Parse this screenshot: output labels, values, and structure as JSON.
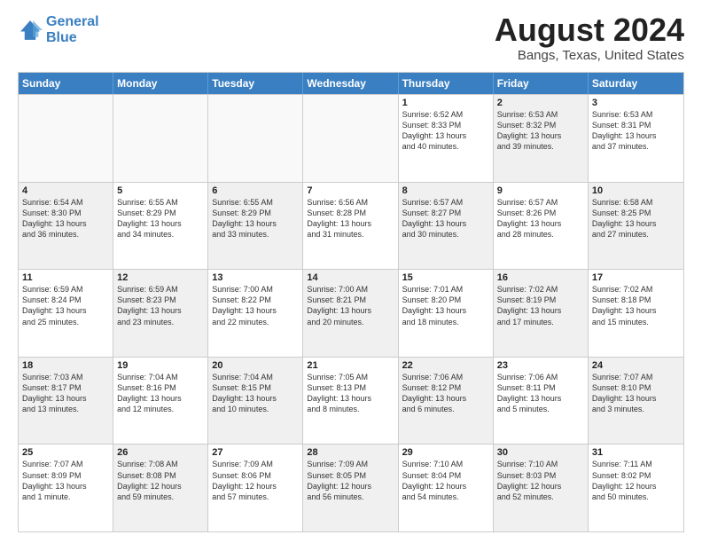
{
  "logo": {
    "line1": "General",
    "line2": "Blue"
  },
  "title": "August 2024",
  "subtitle": "Bangs, Texas, United States",
  "headers": [
    "Sunday",
    "Monday",
    "Tuesday",
    "Wednesday",
    "Thursday",
    "Friday",
    "Saturday"
  ],
  "weeks": [
    [
      {
        "day": "",
        "info": "",
        "shaded": false,
        "empty": true
      },
      {
        "day": "",
        "info": "",
        "shaded": false,
        "empty": true
      },
      {
        "day": "",
        "info": "",
        "shaded": false,
        "empty": true
      },
      {
        "day": "",
        "info": "",
        "shaded": false,
        "empty": true
      },
      {
        "day": "1",
        "info": "Sunrise: 6:52 AM\nSunset: 8:33 PM\nDaylight: 13 hours\nand 40 minutes.",
        "shaded": false,
        "empty": false
      },
      {
        "day": "2",
        "info": "Sunrise: 6:53 AM\nSunset: 8:32 PM\nDaylight: 13 hours\nand 39 minutes.",
        "shaded": true,
        "empty": false
      },
      {
        "day": "3",
        "info": "Sunrise: 6:53 AM\nSunset: 8:31 PM\nDaylight: 13 hours\nand 37 minutes.",
        "shaded": false,
        "empty": false
      }
    ],
    [
      {
        "day": "4",
        "info": "Sunrise: 6:54 AM\nSunset: 8:30 PM\nDaylight: 13 hours\nand 36 minutes.",
        "shaded": true,
        "empty": false
      },
      {
        "day": "5",
        "info": "Sunrise: 6:55 AM\nSunset: 8:29 PM\nDaylight: 13 hours\nand 34 minutes.",
        "shaded": false,
        "empty": false
      },
      {
        "day": "6",
        "info": "Sunrise: 6:55 AM\nSunset: 8:29 PM\nDaylight: 13 hours\nand 33 minutes.",
        "shaded": true,
        "empty": false
      },
      {
        "day": "7",
        "info": "Sunrise: 6:56 AM\nSunset: 8:28 PM\nDaylight: 13 hours\nand 31 minutes.",
        "shaded": false,
        "empty": false
      },
      {
        "day": "8",
        "info": "Sunrise: 6:57 AM\nSunset: 8:27 PM\nDaylight: 13 hours\nand 30 minutes.",
        "shaded": true,
        "empty": false
      },
      {
        "day": "9",
        "info": "Sunrise: 6:57 AM\nSunset: 8:26 PM\nDaylight: 13 hours\nand 28 minutes.",
        "shaded": false,
        "empty": false
      },
      {
        "day": "10",
        "info": "Sunrise: 6:58 AM\nSunset: 8:25 PM\nDaylight: 13 hours\nand 27 minutes.",
        "shaded": true,
        "empty": false
      }
    ],
    [
      {
        "day": "11",
        "info": "Sunrise: 6:59 AM\nSunset: 8:24 PM\nDaylight: 13 hours\nand 25 minutes.",
        "shaded": false,
        "empty": false
      },
      {
        "day": "12",
        "info": "Sunrise: 6:59 AM\nSunset: 8:23 PM\nDaylight: 13 hours\nand 23 minutes.",
        "shaded": true,
        "empty": false
      },
      {
        "day": "13",
        "info": "Sunrise: 7:00 AM\nSunset: 8:22 PM\nDaylight: 13 hours\nand 22 minutes.",
        "shaded": false,
        "empty": false
      },
      {
        "day": "14",
        "info": "Sunrise: 7:00 AM\nSunset: 8:21 PM\nDaylight: 13 hours\nand 20 minutes.",
        "shaded": true,
        "empty": false
      },
      {
        "day": "15",
        "info": "Sunrise: 7:01 AM\nSunset: 8:20 PM\nDaylight: 13 hours\nand 18 minutes.",
        "shaded": false,
        "empty": false
      },
      {
        "day": "16",
        "info": "Sunrise: 7:02 AM\nSunset: 8:19 PM\nDaylight: 13 hours\nand 17 minutes.",
        "shaded": true,
        "empty": false
      },
      {
        "day": "17",
        "info": "Sunrise: 7:02 AM\nSunset: 8:18 PM\nDaylight: 13 hours\nand 15 minutes.",
        "shaded": false,
        "empty": false
      }
    ],
    [
      {
        "day": "18",
        "info": "Sunrise: 7:03 AM\nSunset: 8:17 PM\nDaylight: 13 hours\nand 13 minutes.",
        "shaded": true,
        "empty": false
      },
      {
        "day": "19",
        "info": "Sunrise: 7:04 AM\nSunset: 8:16 PM\nDaylight: 13 hours\nand 12 minutes.",
        "shaded": false,
        "empty": false
      },
      {
        "day": "20",
        "info": "Sunrise: 7:04 AM\nSunset: 8:15 PM\nDaylight: 13 hours\nand 10 minutes.",
        "shaded": true,
        "empty": false
      },
      {
        "day": "21",
        "info": "Sunrise: 7:05 AM\nSunset: 8:13 PM\nDaylight: 13 hours\nand 8 minutes.",
        "shaded": false,
        "empty": false
      },
      {
        "day": "22",
        "info": "Sunrise: 7:06 AM\nSunset: 8:12 PM\nDaylight: 13 hours\nand 6 minutes.",
        "shaded": true,
        "empty": false
      },
      {
        "day": "23",
        "info": "Sunrise: 7:06 AM\nSunset: 8:11 PM\nDaylight: 13 hours\nand 5 minutes.",
        "shaded": false,
        "empty": false
      },
      {
        "day": "24",
        "info": "Sunrise: 7:07 AM\nSunset: 8:10 PM\nDaylight: 13 hours\nand 3 minutes.",
        "shaded": true,
        "empty": false
      }
    ],
    [
      {
        "day": "25",
        "info": "Sunrise: 7:07 AM\nSunset: 8:09 PM\nDaylight: 13 hours\nand 1 minute.",
        "shaded": false,
        "empty": false
      },
      {
        "day": "26",
        "info": "Sunrise: 7:08 AM\nSunset: 8:08 PM\nDaylight: 12 hours\nand 59 minutes.",
        "shaded": true,
        "empty": false
      },
      {
        "day": "27",
        "info": "Sunrise: 7:09 AM\nSunset: 8:06 PM\nDaylight: 12 hours\nand 57 minutes.",
        "shaded": false,
        "empty": false
      },
      {
        "day": "28",
        "info": "Sunrise: 7:09 AM\nSunset: 8:05 PM\nDaylight: 12 hours\nand 56 minutes.",
        "shaded": true,
        "empty": false
      },
      {
        "day": "29",
        "info": "Sunrise: 7:10 AM\nSunset: 8:04 PM\nDaylight: 12 hours\nand 54 minutes.",
        "shaded": false,
        "empty": false
      },
      {
        "day": "30",
        "info": "Sunrise: 7:10 AM\nSunset: 8:03 PM\nDaylight: 12 hours\nand 52 minutes.",
        "shaded": true,
        "empty": false
      },
      {
        "day": "31",
        "info": "Sunrise: 7:11 AM\nSunset: 8:02 PM\nDaylight: 12 hours\nand 50 minutes.",
        "shaded": false,
        "empty": false
      }
    ]
  ]
}
